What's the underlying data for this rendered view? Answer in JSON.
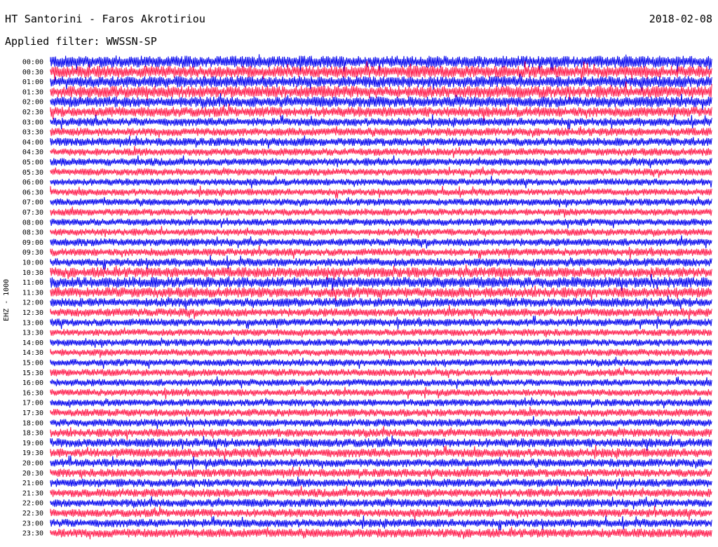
{
  "header": {
    "station": "HT Santorini - Faros Akrotiriou",
    "date": "2018-02-08",
    "filter": "Applied filter: WWSSN-SP",
    "channel": "EHZ - 1000"
  },
  "chart_data": {
    "type": "helicorder",
    "trace_colors": [
      "#0000ee",
      "#ff1a4b"
    ],
    "row_times": [
      "00:00",
      "00:30",
      "01:00",
      "01:30",
      "02:00",
      "02:30",
      "03:00",
      "03:30",
      "04:00",
      "04:30",
      "05:00",
      "05:30",
      "06:00",
      "06:30",
      "07:00",
      "07:30",
      "08:00",
      "08:30",
      "09:00",
      "09:30",
      "10:00",
      "10:30",
      "11:00",
      "11:30",
      "12:00",
      "12:30",
      "13:00",
      "13:30",
      "14:00",
      "14:30",
      "15:00",
      "15:30",
      "16:00",
      "16:30",
      "17:00",
      "17:30",
      "18:00",
      "18:30",
      "19:00",
      "19:30",
      "20:00",
      "20:30",
      "21:00",
      "21:30",
      "22:00",
      "22:30",
      "23:00",
      "23:30"
    ],
    "row_noise_level": [
      1.0,
      1.0,
      0.95,
      1.0,
      0.9,
      0.85,
      0.7,
      0.7,
      0.7,
      0.65,
      0.65,
      0.6,
      0.6,
      0.6,
      0.6,
      0.6,
      0.6,
      0.6,
      0.65,
      0.65,
      0.7,
      0.85,
      0.9,
      0.85,
      0.75,
      0.7,
      0.65,
      0.6,
      0.6,
      0.6,
      0.6,
      0.6,
      0.6,
      0.6,
      0.6,
      0.65,
      0.65,
      0.7,
      0.75,
      0.75,
      0.7,
      0.7,
      0.7,
      0.7,
      0.7,
      0.7,
      0.7,
      0.75
    ]
  }
}
